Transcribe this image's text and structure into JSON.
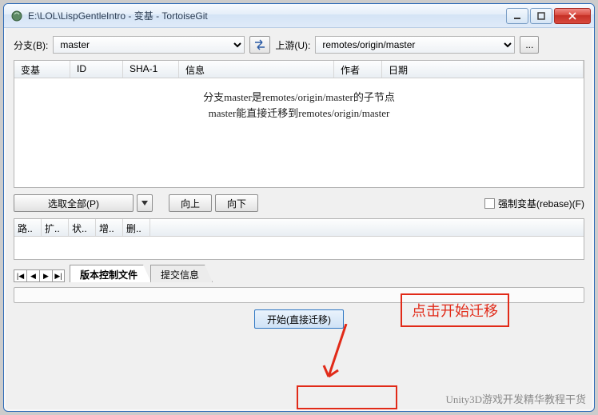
{
  "window": {
    "title": "E:\\LOL\\LispGentleIntro - 变基 - TortoiseGit"
  },
  "row1": {
    "branch_label": "分支(B):",
    "branch_value": "master",
    "upstream_label": "上游(U):",
    "upstream_value": "remotes/origin/master",
    "swap_tooltip": "swap",
    "more_label": "..."
  },
  "columns": {
    "c1": "变基",
    "c2": "ID",
    "c3": "SHA-1",
    "c4": "信息",
    "c5": "作者",
    "c6": "日期"
  },
  "msg_line1": "分支master是remotes/origin/master的子节点",
  "msg_line2": "master能直接迁移到remotes/origin/master",
  "row2": {
    "select_all": "选取全部(P)",
    "up": "向上",
    "down": "向下",
    "force_rebase": "强制变基(rebase)(F)"
  },
  "cols2": {
    "c1": "路..",
    "c2": "扩..",
    "c3": "状..",
    "c4": "增..",
    "c5": "删.."
  },
  "tabs": {
    "t1": "版本控制文件",
    "t2": "提交信息"
  },
  "footer": {
    "start": "开始(直接迁移)"
  },
  "annotation": {
    "text": "点击开始迁移"
  },
  "watermark": "Unity3D游戏开发精华教程干货"
}
